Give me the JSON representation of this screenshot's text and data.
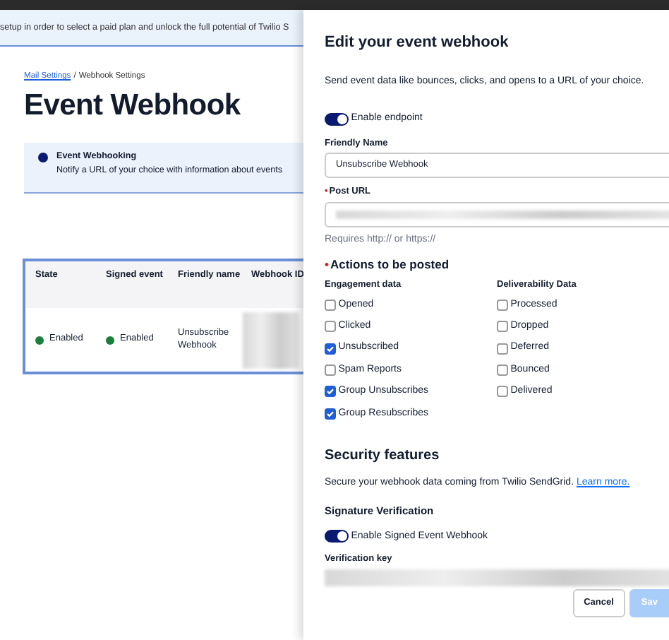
{
  "banner": {
    "text": "setup in order to select a paid plan and unlock the full potential of Twilio S"
  },
  "breadcrumb": [
    {
      "label": "Mail Settings",
      "link": true
    },
    {
      "label": "Webhook Settings",
      "link": false
    }
  ],
  "breadcrumb_separator": "/",
  "title": "Event Webhook",
  "info": {
    "title": "Event Webhooking",
    "text": "Notify a URL of your choice with information about events"
  },
  "table": {
    "columns": [
      "State",
      "Signed event",
      "Friendly name",
      "Webhook ID"
    ],
    "rows": [
      {
        "state": {
          "label": "Enabled",
          "enabled": true
        },
        "signed": {
          "label": "Enabled",
          "enabled": true
        },
        "name": "Unsubscribe Webhook"
      }
    ]
  },
  "panel": {
    "title": "Edit your event webhook",
    "description": "Send event data like bounces, clicks, and opens to a URL of your choice.",
    "enable_endpoint": {
      "label": "Enable endpoint",
      "on": true
    },
    "friendly_name": {
      "label": "Friendly Name",
      "value": "Unsubscribe Webhook"
    },
    "post_url": {
      "label": "Post URL",
      "required_mark": "•",
      "hint": "Requires http:// or https://"
    },
    "actions": {
      "title": "Actions to be posted",
      "required_mark": "•",
      "groups": [
        {
          "title": "Engagement data",
          "items": [
            {
              "label": "Opened",
              "checked": false
            },
            {
              "label": "Clicked",
              "checked": false
            },
            {
              "label": "Unsubscribed",
              "checked": true
            },
            {
              "label": "Spam Reports",
              "checked": false
            },
            {
              "label": "Group Unsubscribes",
              "checked": true
            },
            {
              "label": "Group Resubscribes",
              "checked": true
            }
          ]
        },
        {
          "title": "Deliverability Data",
          "items": [
            {
              "label": "Processed",
              "checked": false
            },
            {
              "label": "Dropped",
              "checked": false
            },
            {
              "label": "Deferred",
              "checked": false
            },
            {
              "label": "Bounced",
              "checked": false
            },
            {
              "label": "Delivered",
              "checked": false
            }
          ]
        }
      ]
    },
    "security": {
      "title": "Security features",
      "text": "Secure your webhook data coming from Twilio SendGrid.",
      "link": "Learn more.",
      "signature_title": "Signature Verification",
      "signed_toggle": {
        "label": "Enable Signed Event Webhook",
        "on": true
      },
      "key_label": "Verification key"
    },
    "buttons": [
      {
        "label": "Cancel",
        "kind": "secondary"
      },
      {
        "label": "Sav",
        "kind": "primary"
      }
    ]
  }
}
